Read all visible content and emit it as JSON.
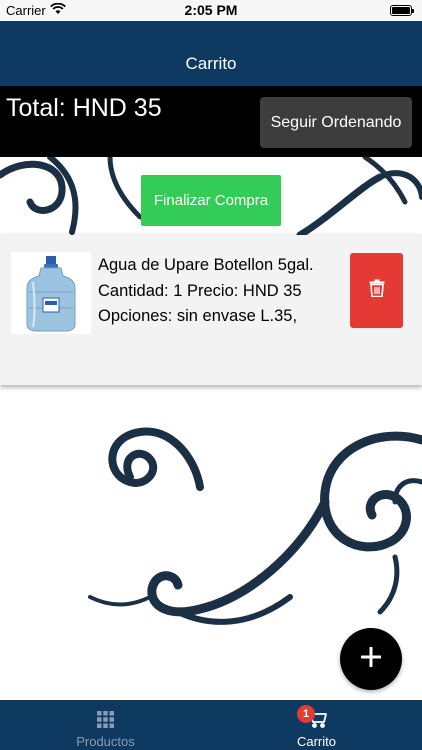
{
  "status_bar": {
    "carrier": "Carrier",
    "time": "2:05 PM"
  },
  "header": {
    "title": "Carrito"
  },
  "cart": {
    "total_label": "Total: HND 35",
    "continue_button": "Seguir Ordenando",
    "checkout_button": "Finalizar Compra",
    "items": [
      {
        "description": "Agua de Upare Botellon 5gal. Cantidad: 1 Precio: HND 35 Opciones: sin envase L.35,",
        "thumbnail": "water-jug-image",
        "delete_icon": "trash-icon"
      }
    ]
  },
  "fab": {
    "icon": "plus-icon"
  },
  "tab_bar": {
    "tabs": [
      {
        "label": "Productos",
        "icon": "grid-icon",
        "active": false
      },
      {
        "label": "Carrito",
        "icon": "cart-icon",
        "active": true,
        "badge": "1"
      }
    ]
  },
  "colors": {
    "navy": "#0e3a61",
    "checkout_green": "#33cc57",
    "delete_red": "#e53935",
    "badge_red": "#e53935"
  }
}
